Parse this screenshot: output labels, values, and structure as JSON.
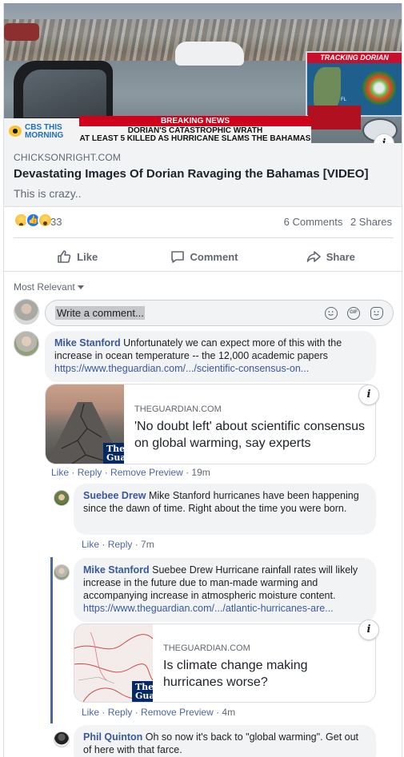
{
  "post": {
    "hero": {
      "tracking_label": "TRACKING DORIAN",
      "map_label": "FL",
      "ticker_banner": "BREAKING NEWS",
      "ticker_line1": "DORIAN'S CATASTROPHIC WRATH",
      "ticker_line2": "AT LEAST 5 KILLED AS HURRICANE SLAMS THE BAHAMAS",
      "network_line1": "CBS THIS",
      "network_line2": "MORNING",
      "info_label": "i"
    },
    "link": {
      "domain": "CHICKSONRIGHT.COM",
      "headline": "Devastating Images Of Dorian Ravaging the Bahamas [VIDEO]",
      "subtext": "This is crazy.."
    },
    "reactions": {
      "count": "33",
      "types": [
        "sad",
        "like",
        "wow"
      ]
    },
    "stats": {
      "comments": "6 Comments",
      "shares": "2 Shares"
    },
    "actions": {
      "like": "Like",
      "comment": "Comment",
      "share": "Share"
    }
  },
  "comments_section": {
    "sort_label": "Most Relevant",
    "write_placeholder": "Write a comment...",
    "composer_icons": [
      "emoji-icon",
      "gif-icon",
      "sticker-icon"
    ],
    "gif_text": "GIF"
  },
  "comments": [
    {
      "author": "Mike Stanford",
      "text": " Unfortunately we can expect more of this with the increase in ocean temperature -- the 12,000 academic papers ",
      "link": "https://www.theguardian.com/.../scientific-consensus-on...",
      "preview": {
        "domain": "THEGUARDIAN.COM",
        "title": "'No doubt left' about scientific consensus on global warming, say experts",
        "logo_text": "The Gua"
      },
      "actions": [
        "Like",
        "Reply",
        "Remove Preview"
      ],
      "time": "19m"
    },
    {
      "author": "Suebee Drew",
      "text": " Mike Stanford hurricanes have been happening since the dawn of time. Right about the time you were born.",
      "actions": [
        "Like",
        "Reply"
      ],
      "time": "7m"
    },
    {
      "author": "Mike Stanford",
      "text": " Suebee Drew Hurricane rainfall rates will likely increase in the future due to man-made warming and accompanying increase in atmospheric moisture content. ",
      "link": "https://www.theguardian.com/.../atlantic-hurricanes-are...",
      "preview": {
        "domain": "THEGUARDIAN.COM",
        "title": "Is climate change making hurricanes worse?",
        "logo_text": "The Gua"
      },
      "actions": [
        "Like",
        "Reply",
        "Remove Preview"
      ],
      "time": "4m"
    },
    {
      "author": "Phil Quinton",
      "text": " Oh so now it's back to \"global warming\". Get out of here with that farce."
    }
  ],
  "separator": " · ",
  "colors": {
    "link_blue": "#385898",
    "facebook_blue": "#1877f2",
    "breaking_red": "#d0021b",
    "guardian_navy": "#052962",
    "thread_line": "#4b67a1"
  }
}
